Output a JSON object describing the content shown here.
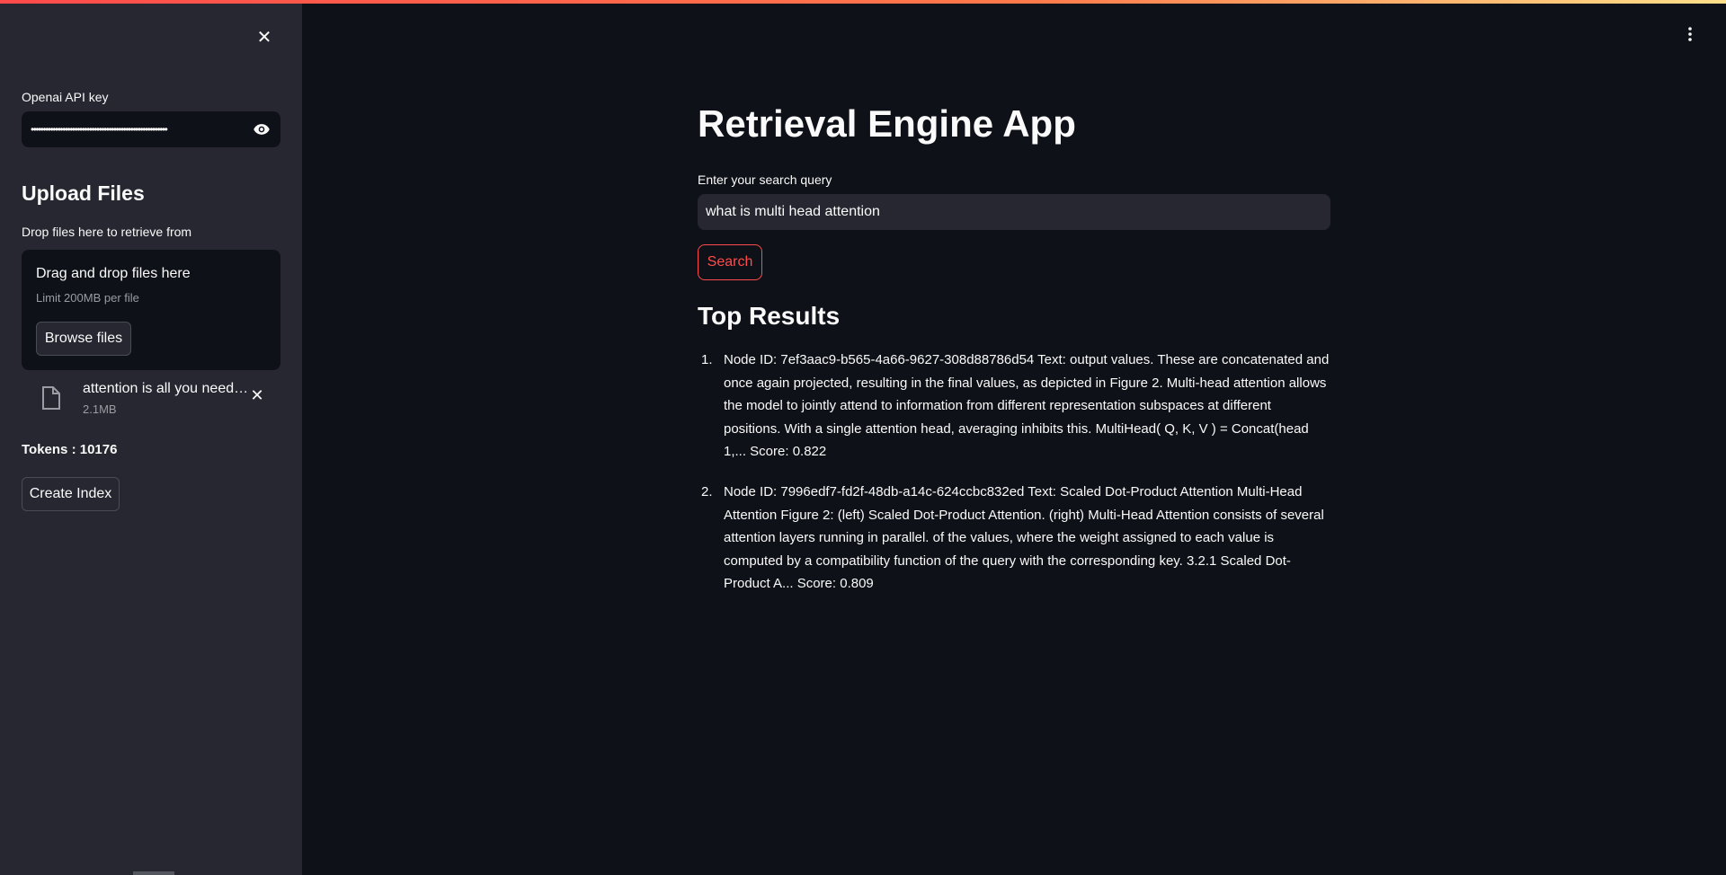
{
  "sidebar": {
    "api_key_label": "Openai API key",
    "api_key_value": "••••••••••••••••••••••••••••••••••••••••••••••••••••••••",
    "upload_title": "Upload Files",
    "upload_label": "Drop files here to retrieve from",
    "dropzone_title": "Drag and drop files here",
    "dropzone_limit": "Limit 200MB per file",
    "browse_label": "Browse files",
    "file": {
      "name": "attention is all you need.pdf",
      "size": "2.1MB"
    },
    "tokens_text": "Tokens : 10176",
    "create_index_label": "Create Index"
  },
  "main": {
    "title": "Retrieval Engine App",
    "query_label": "Enter your search query",
    "query_value": "what is multi head attention",
    "search_label": "Search",
    "results_title": "Top Results",
    "results": [
      {
        "num": "1.",
        "text": "Node ID: 7ef3aac9-b565-4a66-9627-308d88786d54 Text: output values. These are concatenated and once again projected, resulting in the final values, as depicted in Figure 2. Multi-head attention allows the model to jointly attend to information from different representation subspaces at different positions. With a single attention head, averaging inhibits this. MultiHead( Q, K, V ) = Concat(head 1,... Score: 0.822"
      },
      {
        "num": "2.",
        "text": "Node ID: 7996edf7-fd2f-48db-a14c-624ccbc832ed Text: Scaled Dot-Product Attention Multi-Head Attention Figure 2: (left) Scaled Dot-Product Attention. (right) Multi-Head Attention consists of several attention layers running in parallel. of the values, where the weight assigned to each value is computed by a compatibility function of the query with the corresponding key. 3.2.1 Scaled Dot-Product A... Score: 0.809"
      }
    ]
  },
  "colors": {
    "background": "#0e1117",
    "sidebar": "#262730",
    "accent": "#ff4b4b"
  },
  "icons": [
    "close-icon",
    "eye-icon",
    "file-icon",
    "remove-file-icon",
    "more-menu-icon"
  ]
}
